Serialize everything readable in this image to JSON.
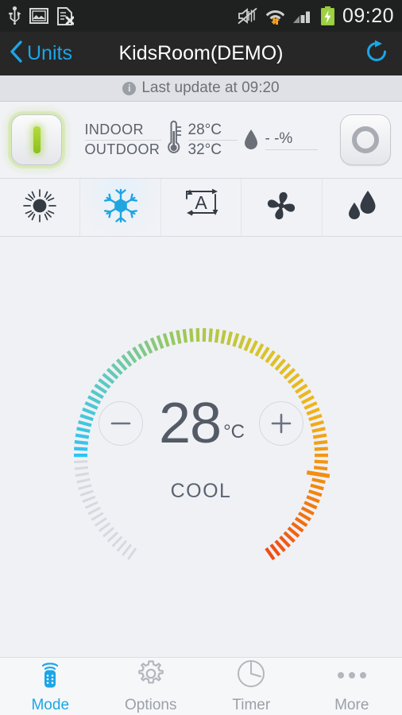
{
  "status_bar": {
    "icons": [
      "usb-icon",
      "screenshot-image-icon",
      "sim-card-error-icon"
    ],
    "right_icons": [
      "sound-muted-icon",
      "wifi-transfer-icon",
      "cellular-signal-icon",
      "battery-charging-icon"
    ],
    "time": "09:20"
  },
  "title_bar": {
    "back_label": "Units",
    "back_icon": "chevron-left-icon",
    "title": "KidsRoom(DEMO)",
    "refresh_icon": "refresh-icon",
    "accent_color": "#1ba6e8"
  },
  "update_bar": {
    "info_icon": "info-icon",
    "text": "Last update at 09:20"
  },
  "info_panel": {
    "power_on": {
      "name": "power-on-button",
      "icon": "power-on-bar-icon",
      "active": true,
      "glow_color": "#a9d642"
    },
    "power_off": {
      "name": "power-off-button",
      "icon": "power-off-circle-icon",
      "active": false
    },
    "thermometer_icon": "thermometer-icon",
    "humidity_icon": "water-droplet-icon",
    "rows": [
      {
        "label": "INDOOR",
        "value": "28°C"
      },
      {
        "label": "OUTDOOR",
        "value": "32°C"
      }
    ],
    "humidity_value": "- -%"
  },
  "mode_row": {
    "modes": [
      {
        "label": "HEAT",
        "icon": "sun-icon",
        "selected": false
      },
      {
        "label": "COOL",
        "icon": "snowflake-icon",
        "selected": true
      },
      {
        "label": "AUTO",
        "icon": "auto-a-icon",
        "selected": false
      },
      {
        "label": "FAN",
        "icon": "fan-icon",
        "selected": false
      },
      {
        "label": "DRY",
        "icon": "droplets-icon",
        "selected": false
      }
    ],
    "selected_color": "#20a5e0",
    "unselected_color": "#343b45"
  },
  "dial": {
    "decrease_label": "−",
    "increase_label": "+",
    "temperature": "28",
    "unit": "°C",
    "mode_name": "COOL",
    "setpoint": 28,
    "min": 16,
    "max": 30,
    "total_ticks": 96,
    "active_ticks": 78,
    "marker_index": 62,
    "start_angle": 125,
    "sweep_angle": 290,
    "gradient_stops": [
      "#2ec4f2",
      "#5fc9c0",
      "#9ac85c",
      "#d6c52a",
      "#f0b41a",
      "#f2860f",
      "#ef4e16"
    ],
    "inactive_color": "#d6d9de",
    "text_color": "#545b66"
  },
  "bottom_nav": {
    "items": [
      {
        "label": "Mode",
        "icon": "remote-control-icon",
        "active": true
      },
      {
        "label": "Options",
        "icon": "gear-icon",
        "active": false
      },
      {
        "label": "Timer",
        "icon": "clock-icon",
        "active": false
      },
      {
        "label": "More",
        "icon": "ellipsis-icon",
        "active": false
      }
    ],
    "active_color": "#1ba6e8",
    "inactive_color": "#9ba0a8"
  }
}
